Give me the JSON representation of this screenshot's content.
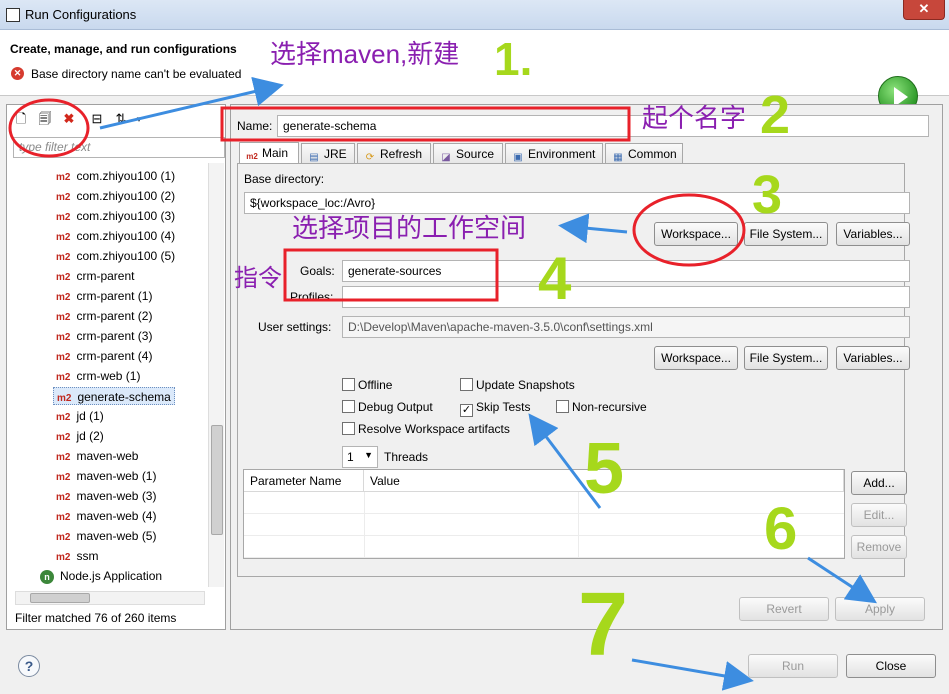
{
  "window": {
    "title": "Run Configurations",
    "close_glyph": "✕"
  },
  "header": {
    "heading": "Create, manage, and run configurations",
    "error_message": "Base directory name can't be evaluated",
    "error_glyph": "✕"
  },
  "left": {
    "filter_placeholder": "type filter text",
    "filter_visible_text": "type filter text",
    "tree_items": [
      {
        "label": "com.zhiyou100 (1)",
        "badge": "m2"
      },
      {
        "label": "com.zhiyou100 (2)",
        "badge": "m2"
      },
      {
        "label": "com.zhiyou100 (3)",
        "badge": "m2"
      },
      {
        "label": "com.zhiyou100 (4)",
        "badge": "m2"
      },
      {
        "label": "com.zhiyou100 (5)",
        "badge": "m2"
      },
      {
        "label": "crm-parent",
        "badge": "m2"
      },
      {
        "label": "crm-parent (1)",
        "badge": "m2"
      },
      {
        "label": "crm-parent (2)",
        "badge": "m2"
      },
      {
        "label": "crm-parent (3)",
        "badge": "m2"
      },
      {
        "label": "crm-parent (4)",
        "badge": "m2"
      },
      {
        "label": "crm-web (1)",
        "badge": "m2"
      },
      {
        "label": "generate-schema",
        "badge": "m2",
        "selected": true
      },
      {
        "label": "jd (1)",
        "badge": "m2"
      },
      {
        "label": "jd (2)",
        "badge": "m2"
      },
      {
        "label": "maven-web",
        "badge": "m2"
      },
      {
        "label": "maven-web (1)",
        "badge": "m2"
      },
      {
        "label": "maven-web (3)",
        "badge": "m2"
      },
      {
        "label": "maven-web (4)",
        "badge": "m2"
      },
      {
        "label": "maven-web (5)",
        "badge": "m2"
      },
      {
        "label": "ssm",
        "badge": "m2"
      },
      {
        "label": "Node.js Application",
        "badge": "n"
      }
    ],
    "filter_status": "Filter matched 76 of 260 items"
  },
  "right": {
    "name_label": "Name:",
    "name_value": "generate-schema",
    "tabs": [
      {
        "label": "Main",
        "icon": "m2"
      },
      {
        "label": "JRE",
        "icon": "jar"
      },
      {
        "label": "Refresh",
        "icon": "refresh"
      },
      {
        "label": "Source",
        "icon": "source"
      },
      {
        "label": "Environment",
        "icon": "environment"
      },
      {
        "label": "Common",
        "icon": "common"
      }
    ],
    "base_dir_label": "Base directory:",
    "base_dir_value": "${workspace_loc:/Avro}",
    "workspace_btn": "Workspace...",
    "filesystem_btn": "File System...",
    "variables_btn": "Variables...",
    "goals_label": "Goals:",
    "goals_value": "generate-sources",
    "profiles_label": "Profiles:",
    "profiles_value": "",
    "user_settings_label": "User settings:",
    "user_settings_value": "D:\\Develop\\Maven\\apache-maven-3.5.0\\conf\\settings.xml",
    "checkboxes": {
      "offline": {
        "label": "Offline",
        "checked": false
      },
      "update_snapshots": {
        "label": "Update Snapshots",
        "checked": false
      },
      "debug_output": {
        "label": "Debug Output",
        "checked": false
      },
      "skip_tests": {
        "label": "Skip Tests",
        "checked": true
      },
      "non_recursive": {
        "label": "Non-recursive",
        "checked": false
      },
      "resolve_workspace": {
        "label": "Resolve Workspace artifacts",
        "checked": false
      }
    },
    "threads_value": "1",
    "threads_label": "Threads",
    "param_headers": [
      "Parameter Name",
      "Value"
    ],
    "add_btn": "Add...",
    "edit_btn": "Edit...",
    "remove_btn": "Remove",
    "revert_btn": "Revert",
    "apply_btn": "Apply"
  },
  "footer": {
    "help_glyph": "?",
    "run_btn": "Run",
    "close_btn": "Close"
  },
  "annotations": {
    "step1_text": "选择maven,新建",
    "step1_num": "1.",
    "step2_text": "起个名字",
    "step2_num": "2",
    "step3_text": "选择项目的工作空间",
    "step3_num": "3",
    "step4_text": "指令",
    "step4_num": "4",
    "step5_num": "5",
    "step6_num": "6",
    "step7_num": "7",
    "text_color": "#8a1fb0",
    "number_color": "#a6d81c",
    "circle_color": "#e8212a",
    "arrow_color": "#3d8de0"
  }
}
